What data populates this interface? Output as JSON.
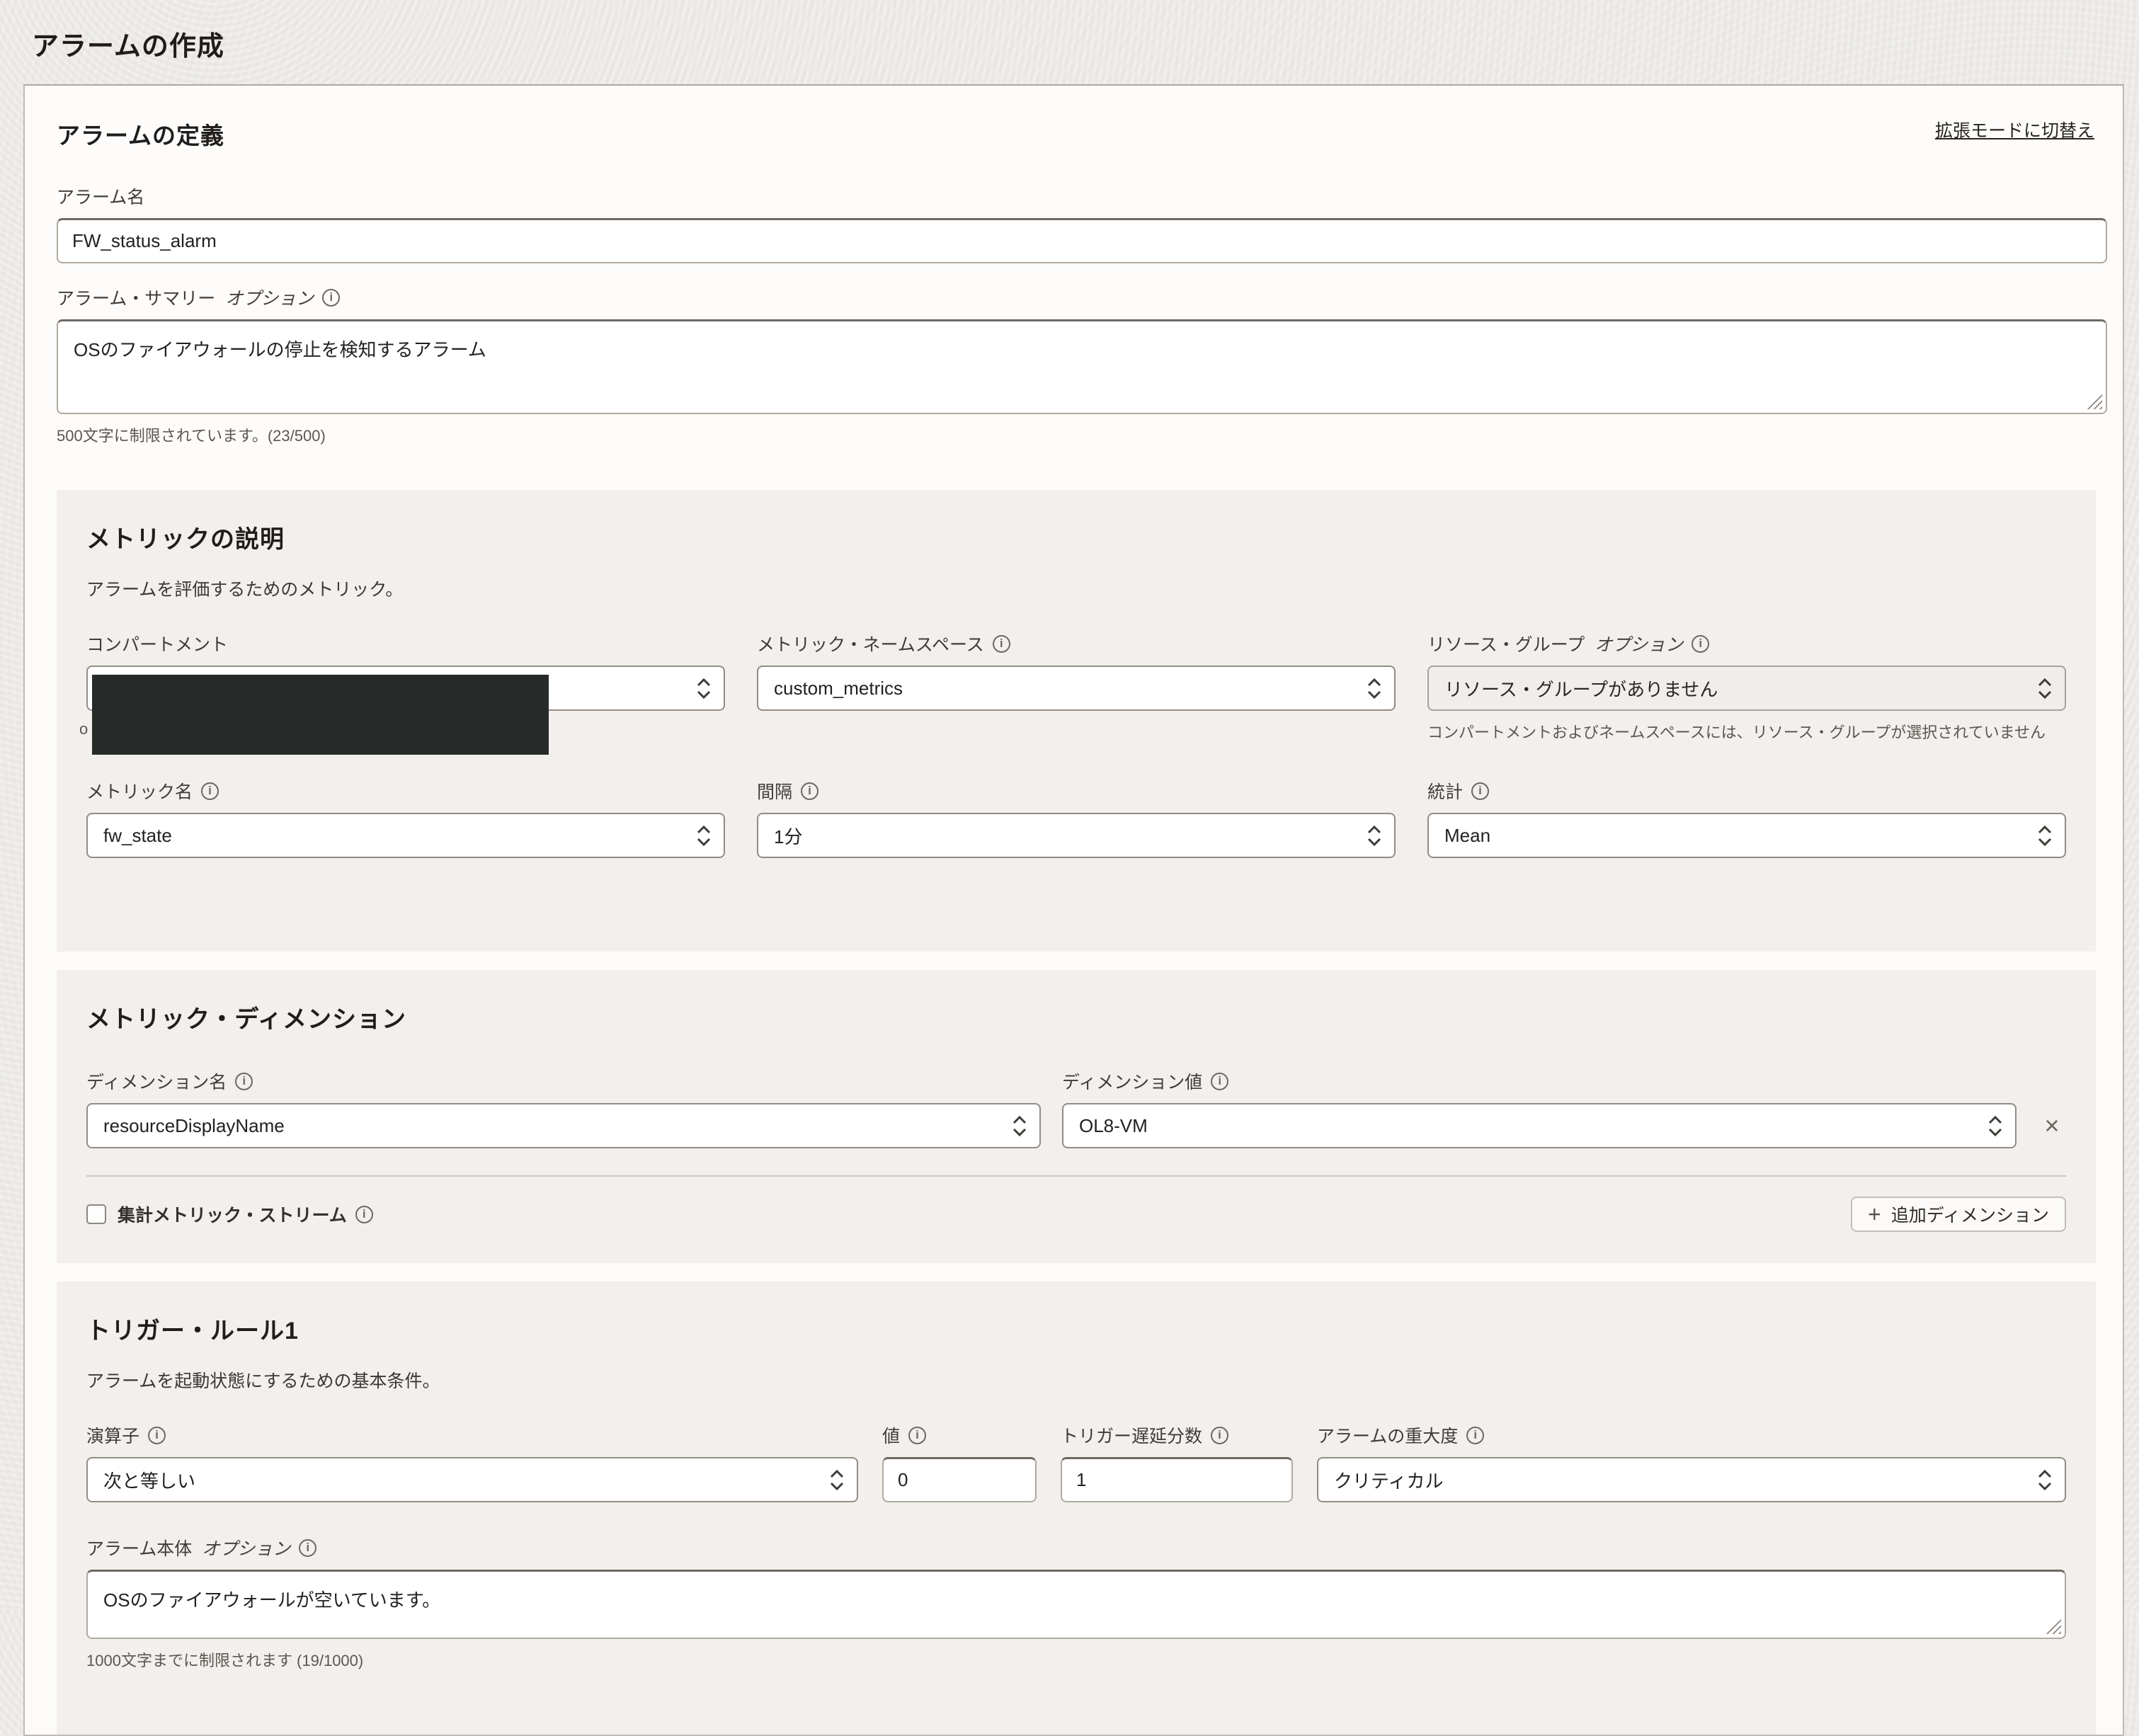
{
  "colors": {
    "redaction": "#262b2a",
    "section_bg": "#f2f0ed",
    "card_bg": "#fdfcfb"
  },
  "page": {
    "title": "アラームの作成"
  },
  "define": {
    "heading": "アラームの定義",
    "switch_mode_link": "拡張モードに切替え",
    "name": {
      "label": "アラーム名",
      "value": "FW_status_alarm"
    },
    "summary": {
      "label": "アラーム・サマリー",
      "optional": "オプション",
      "value": "OSのファイアウォールの停止を検知するアラーム",
      "helper": "500文字に制限されています。(23/500)"
    }
  },
  "metric": {
    "heading": "メトリックの説明",
    "subtitle": "アラームを評価するためのメトリック。",
    "compartment": {
      "label": "コンパートメント",
      "helper_fragment": "o"
    },
    "namespace": {
      "label": "メトリック・ネームスペース",
      "value": "custom_metrics"
    },
    "resource_group": {
      "label": "リソース・グループ",
      "optional": "オプション",
      "value": "リソース・グループがありません",
      "helper": "コンパートメントおよびネームスペースには、リソース・グループが選択されていません"
    },
    "metric_name": {
      "label": "メトリック名",
      "value": "fw_state"
    },
    "interval": {
      "label": "間隔",
      "value": "1分"
    },
    "statistic": {
      "label": "統計",
      "value": "Mean"
    }
  },
  "dimensions": {
    "heading": "メトリック・ディメンション",
    "name": {
      "label": "ディメンション名",
      "value": "resourceDisplayName"
    },
    "value": {
      "label": "ディメンション値",
      "value": "OL8-VM"
    },
    "close_icon": "×",
    "aggregate": {
      "label": "集計メトリック・ストリーム"
    },
    "add_button": {
      "plus": "+",
      "label": "追加ディメンション"
    }
  },
  "trigger": {
    "heading": "トリガー・ルール1",
    "subtitle": "アラームを起動状態にするための基本条件。",
    "operator": {
      "label": "演算子",
      "value": "次と等しい"
    },
    "value": {
      "label": "値",
      "value": "0"
    },
    "delay": {
      "label": "トリガー遅延分数",
      "value": "1"
    },
    "severity": {
      "label": "アラームの重大度",
      "value": "クリティカル"
    },
    "body": {
      "label": "アラーム本体",
      "optional": "オプション",
      "value": "OSのファイアウォールが空いています。",
      "helper": "1000文字までに制限されます (19/1000)"
    }
  }
}
